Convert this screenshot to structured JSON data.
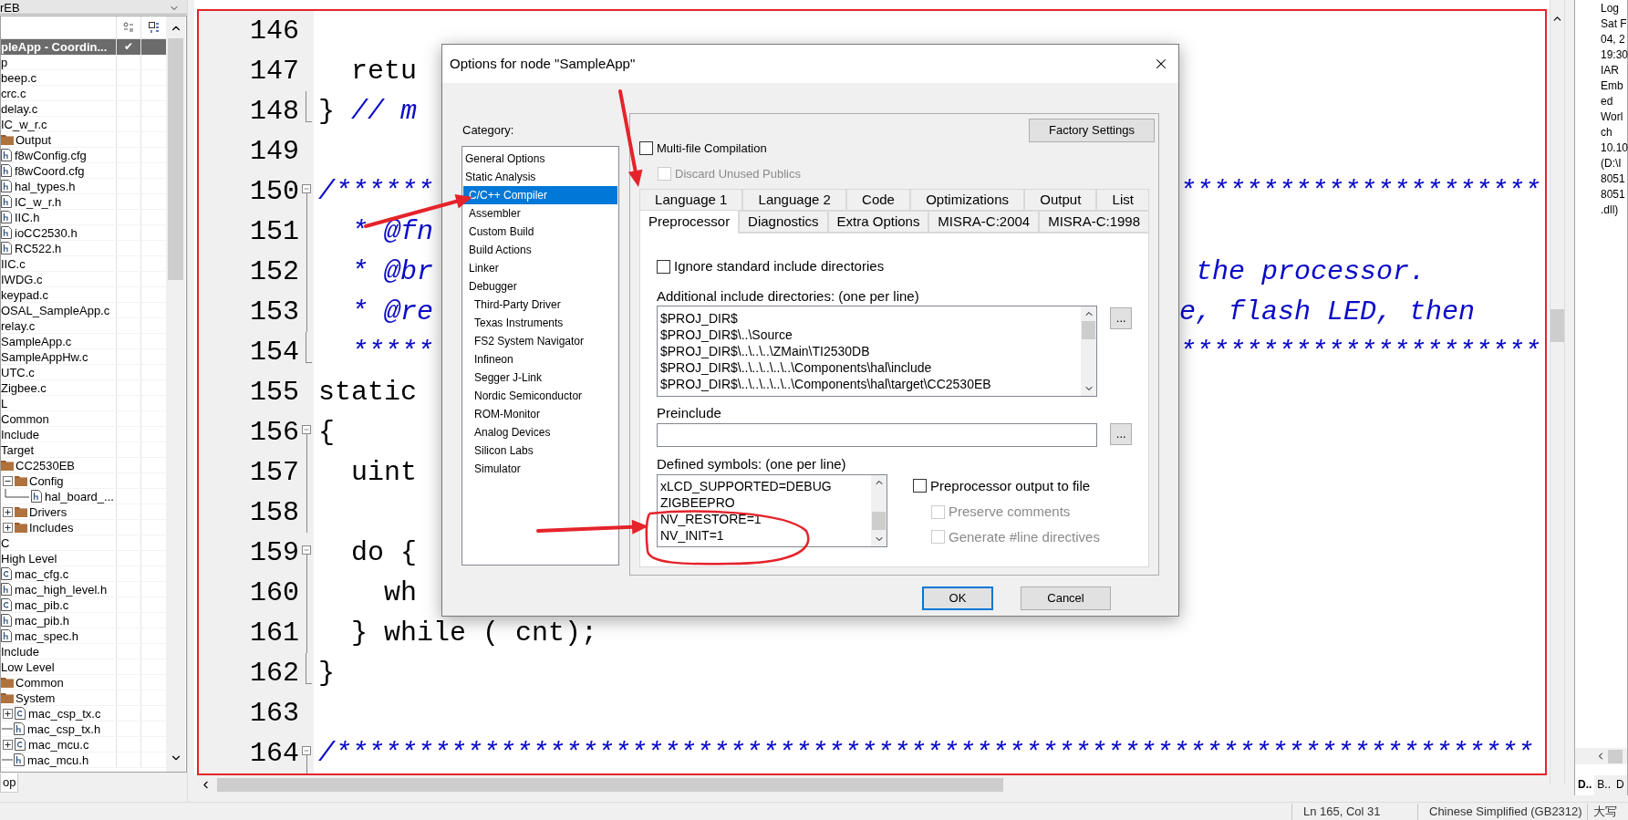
{
  "workspace": {
    "config": "rEB",
    "project": {
      "label": "pleApp - Coordin...",
      "check": "✔",
      "selected": true
    },
    "rows": [
      {
        "label": "p",
        "kind": "text"
      },
      {
        "label": "beep.c",
        "kind": "text"
      },
      {
        "label": "crc.c",
        "kind": "text"
      },
      {
        "label": "delay.c",
        "kind": "text"
      },
      {
        "label": "IC_w_r.c",
        "kind": "text"
      },
      {
        "label": "Output",
        "kind": "folder"
      },
      {
        "label": "f8wConfig.cfg",
        "kind": "h_file"
      },
      {
        "label": "f8wCoord.cfg",
        "kind": "h_file"
      },
      {
        "label": "hal_types.h",
        "kind": "h_file"
      },
      {
        "label": "IC_w_r.h",
        "kind": "h_file"
      },
      {
        "label": "IIC.h",
        "kind": "h_file"
      },
      {
        "label": "ioCC2530.h",
        "kind": "h_file"
      },
      {
        "label": "RC522.h",
        "kind": "h_file"
      },
      {
        "label": "IIC.c",
        "kind": "text"
      },
      {
        "label": "IWDG.c",
        "kind": "text"
      },
      {
        "label": "keypad.c",
        "kind": "text"
      },
      {
        "label": "OSAL_SampleApp.c",
        "kind": "text"
      },
      {
        "label": "relay.c",
        "kind": "text"
      },
      {
        "label": "SampleApp.c",
        "kind": "text"
      },
      {
        "label": "SampleAppHw.c",
        "kind": "text"
      },
      {
        "label": "UTC.c",
        "kind": "text"
      },
      {
        "label": "Zigbee.c",
        "kind": "text"
      },
      {
        "label": "L",
        "kind": "text"
      },
      {
        "label": "Common",
        "kind": "text"
      },
      {
        "label": "Include",
        "kind": "text"
      },
      {
        "label": "Target",
        "kind": "text"
      },
      {
        "label": "CC2530EB",
        "kind": "folder"
      },
      {
        "label": "Config",
        "kind": "folder",
        "expanded": true,
        "children": [
          {
            "label": "hal_board_...",
            "kind": "h_file",
            "tree_line": true
          }
        ]
      },
      {
        "label": "Drivers",
        "kind": "folder",
        "expanded": false
      },
      {
        "label": "Includes",
        "kind": "folder",
        "expanded": false
      },
      {
        "label": "C",
        "kind": "text"
      },
      {
        "label": "High Level",
        "kind": "text"
      },
      {
        "label": "mac_cfg.c",
        "kind": "c_file"
      },
      {
        "label": "mac_high_level.h",
        "kind": "h_file"
      },
      {
        "label": "mac_pib.c",
        "kind": "c_file"
      },
      {
        "label": "mac_pib.h",
        "kind": "h_file"
      },
      {
        "label": "mac_spec.h",
        "kind": "h_file"
      },
      {
        "label": "Include",
        "kind": "text"
      },
      {
        "label": "Low Level",
        "kind": "text"
      },
      {
        "label": "Common",
        "kind": "folder"
      },
      {
        "label": "System",
        "kind": "folder"
      },
      {
        "label": "mac_csp_tx.c",
        "kind": "c_file",
        "expanded": false
      },
      {
        "label": "mac_csp_tx.h",
        "kind": "h_file",
        "tree_line": true
      },
      {
        "label": "mac_mcu.c",
        "kind": "c_file",
        "expanded": false
      },
      {
        "label": "mac_mcu.h",
        "kind": "h_file",
        "tree_line": true
      }
    ],
    "bottom_tab": "op"
  },
  "editor": {
    "lines": [
      {
        "number": "146",
        "kind": "plain"
      },
      {
        "number": "147",
        "kind": "plain",
        "left": [
          {
            "text": "  retu",
            "kind": "code"
          }
        ]
      },
      {
        "number": "148",
        "kind": "fold_end",
        "left": [
          {
            "text": "} ",
            "kind": "code"
          },
          {
            "text": "// m",
            "kind": "comment"
          }
        ]
      },
      {
        "number": "149",
        "kind": "plain"
      },
      {
        "number": "150",
        "kind": "fold_start",
        "left": [
          {
            "text": "/******",
            "kind": "comment"
          }
        ],
        "right": [
          {
            "text": "**********************",
            "kind": "comment"
          }
        ]
      },
      {
        "number": "151",
        "kind": "fold_line",
        "left": [
          {
            "text": "  * @fn",
            "kind": "comment"
          }
        ]
      },
      {
        "number": "152",
        "kind": "fold_line",
        "left": [
          {
            "text": "  * @br",
            "kind": "comment"
          }
        ],
        "right": [
          {
            "text": " the processor.",
            "kind": "comment"
          }
        ]
      },
      {
        "number": "153",
        "kind": "fold_line",
        "left": [
          {
            "text": "  * @re",
            "kind": "comment"
          }
        ],
        "right": [
          {
            "text": "e, flash LED, then",
            "kind": "comment"
          }
        ]
      },
      {
        "number": "154",
        "kind": "fold_end",
        "left": [
          {
            "text": "  *****",
            "kind": "comment"
          }
        ],
        "right": [
          {
            "text": "**********************",
            "kind": "comment"
          }
        ]
      },
      {
        "number": "155",
        "kind": "plain",
        "left": [
          {
            "text": "static",
            "kind": "code"
          }
        ]
      },
      {
        "number": "156",
        "kind": "fold_start",
        "left": [
          {
            "text": "{",
            "kind": "code"
          }
        ]
      },
      {
        "number": "157",
        "kind": "fold_line",
        "left": [
          {
            "text": "  uint",
            "kind": "code"
          }
        ]
      },
      {
        "number": "158",
        "kind": "fold_line"
      },
      {
        "number": "159",
        "kind": "fold_start",
        "left": [
          {
            "text": "  do {",
            "kind": "code"
          }
        ]
      },
      {
        "number": "160",
        "kind": "fold_line",
        "left": [
          {
            "text": "    wh",
            "kind": "code"
          }
        ]
      },
      {
        "number": "161",
        "kind": "fold_line",
        "left": [
          {
            "text": "  } while ( cnt);",
            "kind": "code"
          }
        ]
      },
      {
        "number": "162",
        "kind": "fold_end",
        "left": [
          {
            "text": "}",
            "kind": "code"
          }
        ]
      },
      {
        "number": "163",
        "kind": "plain"
      },
      {
        "number": "164",
        "kind": "fold_start",
        "left": [
          {
            "text": "/*************************************************************************",
            "kind": "comment"
          }
        ]
      }
    ]
  },
  "dialog": {
    "title": "Options for node \"SampleApp\"",
    "category_label": "Category:",
    "categories": [
      {
        "label": "General Options",
        "selected": false
      },
      {
        "label": "Static Analysis",
        "selected": false
      },
      {
        "label": "C/C++ Compiler",
        "selected": true
      },
      {
        "label": "Assembler",
        "selected": false
      },
      {
        "label": "Custom Build",
        "selected": false
      },
      {
        "label": "Build Actions",
        "selected": false
      },
      {
        "label": "Linker",
        "selected": false
      },
      {
        "label": "Debugger",
        "selected": false,
        "children": [
          {
            "label": "Third-Party Driver",
            "selected": false
          },
          {
            "label": "Texas Instruments",
            "selected": false
          },
          {
            "label": "FS2 System Navigator",
            "selected": false
          },
          {
            "label": "Infineon",
            "selected": false
          },
          {
            "label": "Segger J-Link",
            "selected": false
          },
          {
            "label": "Nordic Semiconductor",
            "selected": false
          },
          {
            "label": "ROM-Monitor",
            "selected": false
          },
          {
            "label": "Analog Devices",
            "selected": false
          },
          {
            "label": "Silicon Labs",
            "selected": false
          },
          {
            "label": "Simulator",
            "selected": false
          }
        ]
      }
    ],
    "factory_button": "Factory Settings",
    "options": [
      {
        "label": "Multi-file Compilation",
        "checked": false,
        "disabled": false
      },
      {
        "label": "Discard Unused Publics",
        "checked": false,
        "disabled": true
      }
    ],
    "tab_rows": [
      [
        {
          "label": "Language 1",
          "selected": false
        },
        {
          "label": "Language 2",
          "selected": false
        },
        {
          "label": "Code",
          "selected": false
        },
        {
          "label": "Optimizations",
          "selected": false
        },
        {
          "label": "Output",
          "selected": false
        },
        {
          "label": "List",
          "selected": false
        }
      ],
      [
        {
          "label": "Preprocessor",
          "selected": true
        },
        {
          "label": "Diagnostics",
          "selected": false
        },
        {
          "label": "Extra Options",
          "selected": false
        },
        {
          "label": "MISRA-C:2004",
          "selected": false
        },
        {
          "label": "MISRA-C:1998",
          "selected": false
        }
      ]
    ],
    "ignore_option": {
      "label": "Ignore standard include directories",
      "checked": false,
      "disabled": false
    },
    "include_label": "Additional include directories: (one per line)",
    "include_dirs": [
      "$PROJ_DIR$",
      "$PROJ_DIR$\\..\\Source",
      "$PROJ_DIR$\\..\\..\\..\\ZMain\\TI2530DB",
      "$PROJ_DIR$\\..\\..\\..\\..\\..\\Components\\hal\\include",
      "$PROJ_DIR$\\..\\..\\..\\..\\..\\Components\\hal\\target\\CC2530EB"
    ],
    "include_browse": "...",
    "preinclude_label": "Preinclude",
    "preinclude_browse": "...",
    "symbols_label": "Defined symbols: (one per line)",
    "symbols": [
      "xLCD_SUPPORTED=DEBUG",
      "ZIGBEEPRO",
      "NV_RESTORE=1",
      "NV_INIT=1"
    ],
    "output_options": [
      {
        "label": "Preprocessor output to file",
        "checked": false,
        "disabled": false
      },
      {
        "label": "Preserve comments",
        "checked": false,
        "disabled": true
      },
      {
        "label": "Generate #line directives",
        "checked": false,
        "disabled": true
      }
    ],
    "buttons": [
      {
        "label": "OK",
        "default": true
      },
      {
        "label": "Cancel",
        "default": false
      }
    ]
  },
  "log": {
    "title": "Log",
    "lines": [
      "Sat F",
      "04, 2",
      "19:30",
      "IAR",
      "Emb",
      "ed",
      "Worl",
      "ch",
      "10.10",
      "(D:\\I",
      "8051",
      "8051",
      ".dll)"
    ]
  },
  "log_tabs": [
    {
      "label": "D..",
      "selected": true
    },
    {
      "label": "B..",
      "selected": false
    },
    {
      "label": "D",
      "selected": false
    }
  ],
  "status_bar": {
    "position": "Ln 165, Col 31",
    "encoding": "Chinese Simplified (GB2312)",
    "caps": "大写"
  }
}
